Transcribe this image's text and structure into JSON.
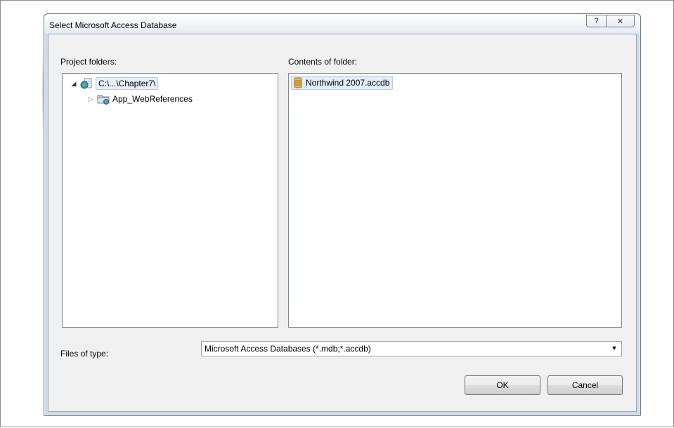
{
  "dialog": {
    "title": "Select Microsoft Access Database",
    "help_glyph": "?",
    "close_glyph": "✕"
  },
  "project_folders": {
    "label": "Project folders:",
    "tree": [
      {
        "name": "C:\\...\\Chapter7\\",
        "expanded": true,
        "selected": true,
        "icon": "web-project-icon"
      },
      {
        "name": "App_WebReferences",
        "expanded": false,
        "selected": false,
        "icon": "web-references-folder-icon"
      }
    ]
  },
  "contents": {
    "label": "Contents of folder:",
    "files": [
      {
        "name": "Northwind 2007.accdb",
        "icon": "access-database-icon"
      }
    ]
  },
  "file_type": {
    "label": "Files of type:",
    "selected": "Microsoft Access Databases (*.mdb;*.accdb)"
  },
  "buttons": {
    "ok": "OK",
    "cancel": "Cancel"
  }
}
